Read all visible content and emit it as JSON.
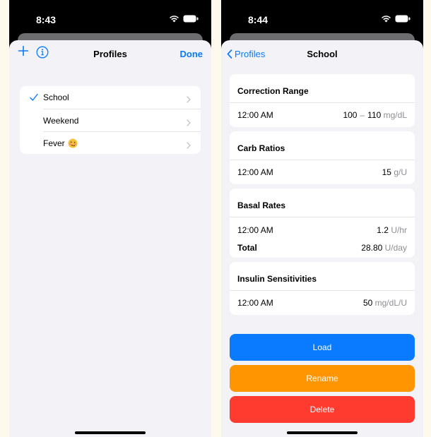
{
  "left": {
    "status_time": "8:43",
    "nav": {
      "title": "Profiles",
      "done_label": "Done"
    },
    "profiles": [
      {
        "label": "School",
        "selected": true
      },
      {
        "label": "Weekend",
        "selected": false
      },
      {
        "label": "Fever",
        "selected": false,
        "emoji_icon": "woozy-face-icon"
      }
    ]
  },
  "right": {
    "status_time": "8:44",
    "nav": {
      "back_label": "Profiles",
      "title": "School"
    },
    "correction_range": {
      "title": "Correction Range",
      "time": "12:00 AM",
      "low": "100",
      "dash": "–",
      "high": "110",
      "unit": "mg/dL"
    },
    "carb_ratios": {
      "title": "Carb Ratios",
      "time": "12:00 AM",
      "value": "15",
      "unit": "g/U"
    },
    "basal_rates": {
      "title": "Basal Rates",
      "time": "12:00 AM",
      "value": "1.2",
      "unit": "U/hr",
      "total_label": "Total",
      "total_value": "28.80",
      "total_unit": "U/day"
    },
    "insulin_sensitivities": {
      "title": "Insulin Sensitivities",
      "time": "12:00 AM",
      "value": "50",
      "unit": "mg/dL/U"
    },
    "buttons": {
      "load": "Load",
      "rename": "Rename",
      "delete": "Delete"
    }
  },
  "colors": {
    "accent": "#0a7aff",
    "load": "#0a7aff",
    "rename": "#ff9500",
    "delete": "#ff3b30",
    "background": "#fdf9ec"
  }
}
